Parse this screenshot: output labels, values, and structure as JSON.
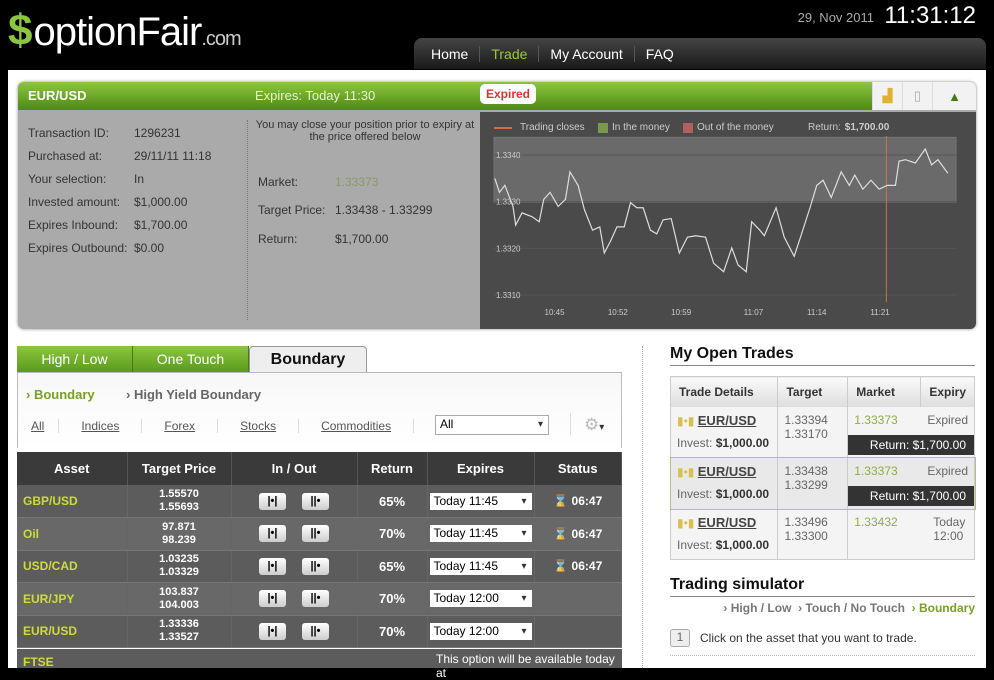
{
  "header": {
    "logo": "optionFair.com",
    "logo_main": "optionFair",
    "logo_suffix": ".com",
    "date": "29, Nov 2011",
    "time": "11:31:12",
    "nav": [
      "Home",
      "Trade",
      "My Account",
      "FAQ"
    ],
    "active_nav": "Trade"
  },
  "trade_card": {
    "pair": "EUR/USD",
    "expires": "Expires:  Today 11:30",
    "status": "Expired",
    "details": [
      {
        "label": "Transaction ID:",
        "value": "1296231"
      },
      {
        "label": "Purchased at:",
        "value": "29/11/11 11:18"
      },
      {
        "label": "Your selection:",
        "value": "In"
      },
      {
        "label": "Invested amount:",
        "value": "$1,000.00"
      },
      {
        "label": "Expires Inbound:",
        "value": "$1,700.00"
      },
      {
        "label": "Expires Outbound:",
        "value": "$0.00"
      }
    ],
    "close_note": "You may close your position prior to expiry at the price offered below",
    "market_label": "Market:",
    "market": "1.33373",
    "target_label": "Target Price:",
    "target": "1.33438 - 1.33299",
    "return_label": "Return:",
    "return": "$1,700.00"
  },
  "chart_data": {
    "type": "line",
    "legend": [
      "Trading closes",
      "In the money",
      "Out of the money"
    ],
    "return_label": "Return:",
    "return_value": "$1,700.00",
    "colors": {
      "line": "#dddddd",
      "closes": "#d86a4a",
      "in_money": "#7a9a4a",
      "out_money": "#b06060",
      "band": "#6a6a6a"
    },
    "band": [
      1.33299,
      1.33438
    ],
    "trading_close_x": 81.7,
    "xlim": [
      38.3,
      89.4
    ],
    "ylim": [
      1.33085,
      1.33428
    ],
    "x_ticks": [
      {
        "x": 45,
        "label": "10:45"
      },
      {
        "x": 52,
        "label": "10:52"
      },
      {
        "x": 59,
        "label": "10:59"
      },
      {
        "x": 67,
        "label": "11:07"
      },
      {
        "x": 74,
        "label": "11:14"
      },
      {
        "x": 81,
        "label": "11:21"
      }
    ],
    "y_ticks": [
      {
        "y": 1.334,
        "label": "1.3340"
      },
      {
        "y": 1.333,
        "label": "1.3330"
      },
      {
        "y": 1.332,
        "label": "1.3320"
      },
      {
        "y": 1.331,
        "label": "1.3310"
      }
    ],
    "x": [
      38.4,
      38.9,
      39.5,
      40.4,
      40.7,
      41.4,
      42.5,
      43.3,
      43.8,
      44.5,
      45.4,
      46.2,
      46.7,
      47.6,
      48.3,
      49.2,
      50.0,
      50.5,
      51.2,
      51.9,
      52.7,
      53.4,
      54.1,
      54.8,
      55.6,
      56.3,
      57.0,
      57.9,
      58.8,
      59.7,
      60.6,
      61.7,
      62.6,
      63.7,
      64.6,
      65.3,
      66.2,
      66.8,
      67.7,
      68.2,
      69.5,
      70.4,
      71.5,
      72.2,
      73.3,
      74.0,
      74.7,
      75.6,
      76.7,
      77.6,
      78.2,
      79.1,
      80.0,
      80.9,
      81.8,
      82.7,
      83.1,
      83.8,
      84.9,
      86.0,
      86.7,
      87.4,
      88.5
    ],
    "y": [
      1.3335,
      1.3332,
      1.33335,
      1.3329,
      1.3325,
      1.33276,
      1.33268,
      1.33257,
      1.33305,
      1.3332,
      1.3329,
      1.33305,
      1.33364,
      1.33335,
      1.33283,
      1.33239,
      1.33246,
      1.3319,
      1.33216,
      1.33246,
      1.33246,
      1.33298,
      1.33287,
      1.33287,
      1.33239,
      1.33231,
      1.33261,
      1.33264,
      1.3319,
      1.33224,
      1.33227,
      1.33224,
      1.33168,
      1.3315,
      1.33201,
      1.33164,
      1.3315,
      1.33257,
      1.33239,
      1.33227,
      1.33287,
      1.33224,
      1.33183,
      1.33224,
      1.3329,
      1.33335,
      1.33346,
      1.33309,
      1.33364,
      1.33335,
      1.33357,
      1.33327,
      1.33346,
      1.33327,
      1.33335,
      1.33335,
      1.33387,
      1.3339,
      1.33383,
      1.33413,
      1.33379,
      1.3339,
      1.33361
    ]
  },
  "tabs": [
    "High / Low",
    "One Touch",
    "Boundary"
  ],
  "active_tab": "Boundary",
  "subtabs": [
    "Boundary",
    "High Yield Boundary"
  ],
  "filters": [
    "All",
    "Indices",
    "Forex",
    "Stocks",
    "Commodities"
  ],
  "filter_select": "All",
  "table": {
    "headers": [
      "Asset",
      "Target Price",
      "In / Out",
      "Return",
      "Expires",
      "Status"
    ],
    "rows": [
      {
        "asset": "GBP/USD",
        "t1": "1.55570",
        "t2": "1.55693",
        "ret": "65%",
        "exp": "Today 11:45",
        "status": "06:47"
      },
      {
        "asset": "Oil",
        "t1": "97.871",
        "t2": "98.239",
        "ret": "70%",
        "exp": "Today 11:45",
        "status": "06:47"
      },
      {
        "asset": "USD/CAD",
        "t1": "1.03235",
        "t2": "1.03329",
        "ret": "65%",
        "exp": "Today 11:45",
        "status": "06:47"
      },
      {
        "asset": "EUR/JPY",
        "t1": "103.837",
        "t2": "104.003",
        "ret": "70%",
        "exp": "Today 12:00",
        "status": ""
      },
      {
        "asset": "EUR/USD",
        "t1": "1.33336",
        "t2": "1.33527",
        "ret": "70%",
        "exp": "Today 12:00",
        "status": ""
      }
    ],
    "partial_row": {
      "asset": "FTSE",
      "note": "This option will be available today at"
    }
  },
  "open_trades": {
    "title": "My Open Trades",
    "headers": [
      "Trade Details",
      "Target",
      "Market",
      "Expiry"
    ],
    "rows": [
      {
        "pair": "EUR/USD",
        "invest_label": "Invest:",
        "invest": "$1,000.00",
        "t1": "1.33394",
        "t2": "1.33170",
        "market": "1.33373",
        "expiry": "Expired",
        "ret": "Return: $1,700.00"
      },
      {
        "pair": "EUR/USD",
        "invest_label": "Invest:",
        "invest": "$1,000.00",
        "t1": "1.33438",
        "t2": "1.33299",
        "market": "1.33373",
        "expiry": "Expired",
        "ret": "Return: $1,700.00"
      },
      {
        "pair": "EUR/USD",
        "invest_label": "Invest:",
        "invest": "$1,000.00",
        "t1": "1.33496",
        "t2": "1.33300",
        "market": "1.33432",
        "expiry": "Today 12:00",
        "ret": ""
      }
    ]
  },
  "simulator": {
    "title": "Trading simulator",
    "links": [
      "High / Low",
      "Touch / No Touch",
      "Boundary"
    ],
    "step_num": "1",
    "step": "Click on the asset that you want to trade."
  }
}
